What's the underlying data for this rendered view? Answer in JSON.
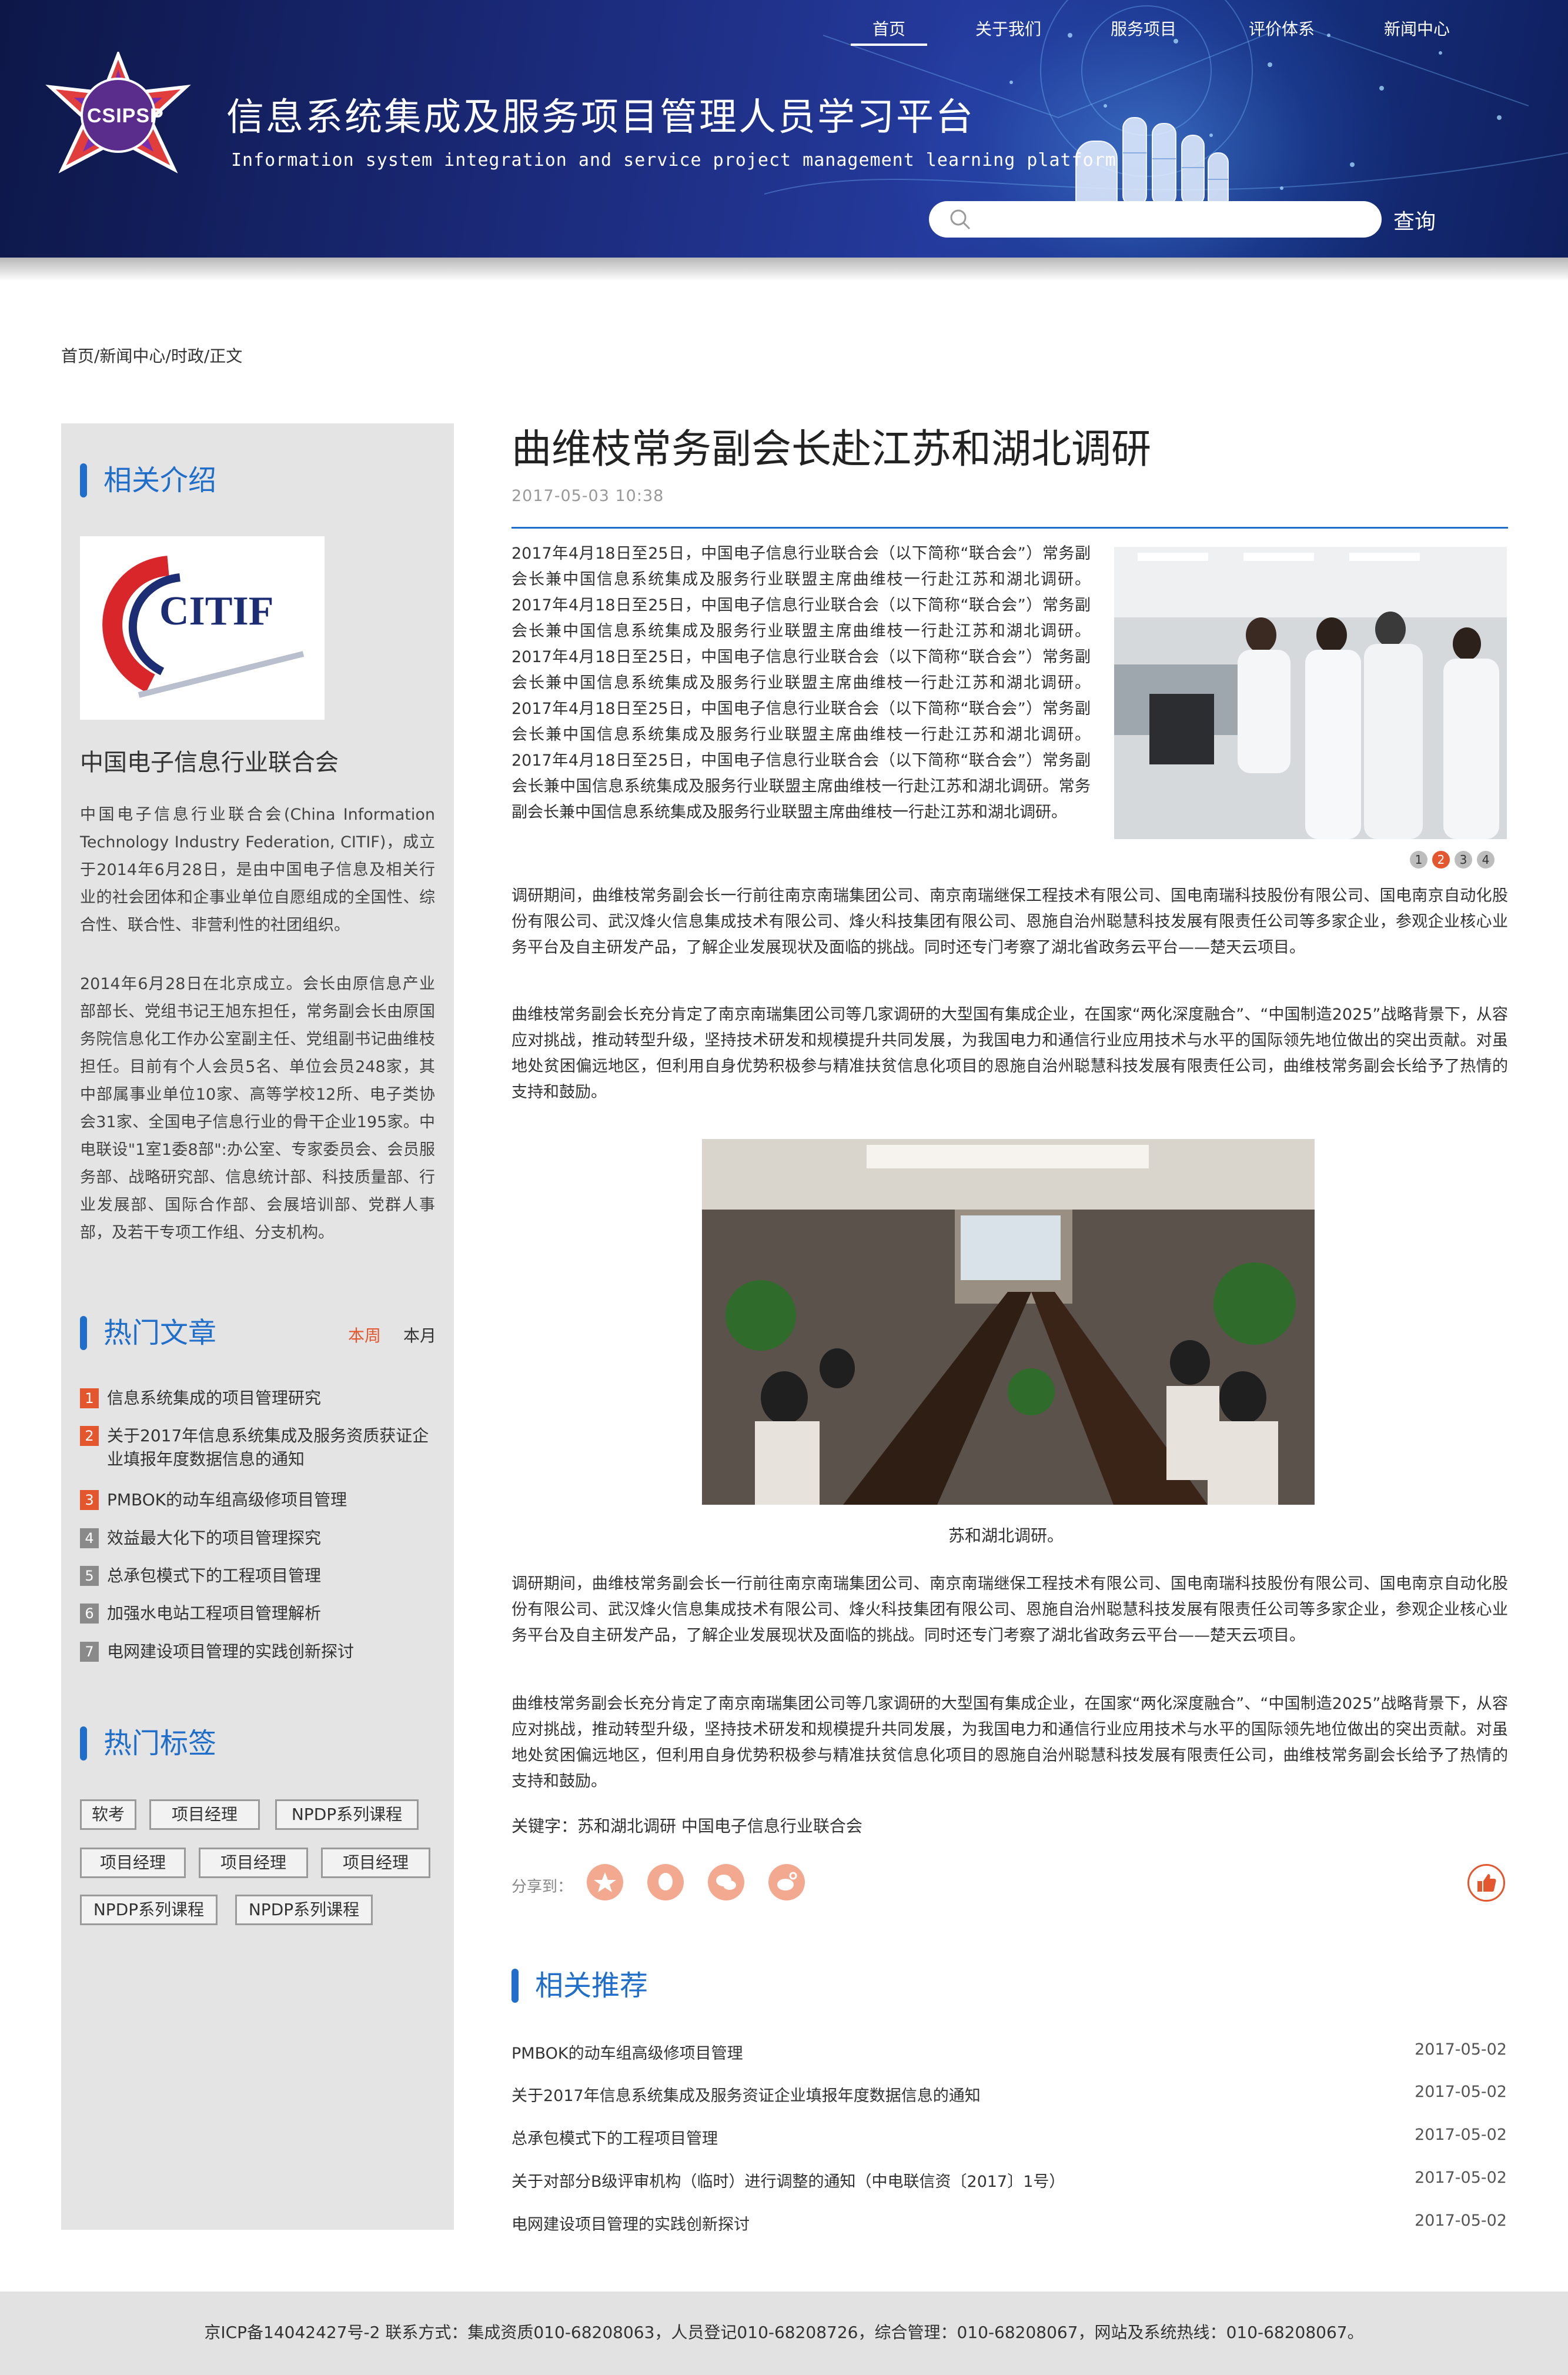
{
  "header": {
    "logo_text": "CSIPSP",
    "title": "信息系统集成及服务项目管理人员学习平台",
    "subtitle": "Information system integration and service project management learning platform",
    "nav": [
      "首页",
      "关于我们",
      "服务项目",
      "评价体系",
      "新闻中心"
    ],
    "active_nav": "首页",
    "search": {
      "placeholder": "",
      "button_label": "查询"
    }
  },
  "breadcrumb": "首页/新闻中心/时政/正文",
  "sidebar": {
    "intro": {
      "heading": "相关介绍",
      "image_logo_text": "CITIF",
      "org_name": "中国电子信息行业联合会",
      "paragraphs": [
        "中国电子信息行业联合会(China Information Technology Industry Federation, CITIF)，成立于2014年6月28日，是由中国电子信息及相关行业的社会团体和企事业单位自愿组成的全国性、综合性、联合性、非营利性的社团组织。",
        "2014年6月28日在北京成立。会长由原信息产业部部长、党组书记王旭东担任，常务副会长由原国务院信息化工作办公室副主任、党组副书记曲维枝担任。目前有个人会员5名、单位会员248家，其中部属事业单位10家、高等学校12所、电子类协会31家、全国电子信息行业的骨干企业195家。中电联设\"1室1委8部\":办公室、专家委员会、会员服务部、战略研究部、信息统计部、科技质量部、行业发展部、国际合作部、会展培训部、党群人事部，及若干专项工作组、分支机构。"
      ]
    },
    "hot_articles": {
      "heading": "热门文章",
      "tabs": [
        "本周",
        "本月"
      ],
      "items": [
        {
          "num": "1",
          "title": "信息系统集成的项目管理研究"
        },
        {
          "num": "2",
          "title": "关于2017年信息系统集成及服务资质获证企业填报年度数据信息的通知"
        },
        {
          "num": "3",
          "title": "PMBOK的动车组高级修项目管理"
        },
        {
          "num": "4",
          "title": "效益最大化下的项目管理探究"
        },
        {
          "num": "5",
          "title": "总承包模式下的工程项目管理"
        },
        {
          "num": "6",
          "title": "加强水电站工程项目管理解析"
        },
        {
          "num": "7",
          "title": "电网建设项目管理的实践创新探讨"
        }
      ]
    },
    "hot_tags": {
      "heading": "热门标签",
      "tags": [
        "软考",
        "项目经理",
        "NPDP系列课程",
        "项目经理",
        "项目经理",
        "项目经理",
        "NPDP系列课程",
        "NPDP系列课程"
      ]
    }
  },
  "article": {
    "title": "曲维枝常务副会长赴江苏和湖北调研",
    "date": "2017-05-03 10:38",
    "intro": "2017年4月18日至25日，中国电子信息行业联合会（以下简称“联合会”）常务副会长兼中国信息系统集成及服务行业联盟主席曲维枝一行赴江苏和湖北调研。2017年4月18日至25日，中国电子信息行业联合会（以下简称“联合会”）常务副会长兼中国信息系统集成及服务行业联盟主席曲维枝一行赴江苏和湖北调研。2017年4月18日至25日，中国电子信息行业联合会（以下简称“联合会”）常务副会长兼中国信息系统集成及服务行业联盟主席曲维枝一行赴江苏和湖北调研。2017年4月18日至25日，中国电子信息行业联合会（以下简称“联合会”）常务副会长兼中国信息系统集成及服务行业联盟主席曲维枝一行赴江苏和湖北调研。2017年4月18日至25日，中国电子信息行业联合会（以下简称“联合会”）常务副会长兼中国信息系统集成及服务行业联盟主席曲维枝一行赴江苏和湖北调研。常务副会长兼中国信息系统集成及服务行业联盟主席曲维枝一行赴江苏和湖北调研。",
    "slider_pages": [
      "1",
      "2",
      "3",
      "4"
    ],
    "slider_active": "2",
    "para_visit": "调研期间，曲维枝常务副会长一行前往南京南瑞集团公司、南京南瑞继保工程技术有限公司、国电南瑞科技股份有限公司、国电南京自动化股份有限公司、武汉烽火信息集成技术有限公司、烽火科技集团有限公司、恩施自治州聪慧科技发展有限责任公司等多家企业，参观企业核心业务平台及自主研发产品，了解企业发展现状及面临的挑战。同时还专门考察了湖北省政务云平台——楚天云项目。",
    "para_affirm": "曲维枝常务副会长充分肯定了南京南瑞集团公司等几家调研的大型国有集成企业，在国家“两化深度融合”、“中国制造2025”战略背景下，从容应对挑战，推动转型升级，坚持技术研发和规模提升共同发展，为我国电力和通信行业应用技术与水平的国际领先地位做出的突出贡献。对虽地处贫困偏远地区，但利用自身优势积极参与精准扶贫信息化项目的恩施自治州聪慧科技发展有限责任公司，曲维枝常务副会长给予了热情的支持和鼓励。",
    "caption": "苏和湖北调研。",
    "keywords": "关键字：苏和湖北调研   中国电子信息行业联合会",
    "share_label": "分享到：",
    "share_icons": [
      "qzone-icon",
      "qq-icon",
      "wechat-icon",
      "weibo-icon"
    ]
  },
  "recommend": {
    "heading": "相关推荐",
    "items": [
      {
        "title": "PMBOK的动车组高级修项目管理",
        "date": "2017-05-02"
      },
      {
        "title": "关于2017年信息系统集成及服务资证企业填报年度数据信息的通知",
        "date": "2017-05-02"
      },
      {
        "title": "总承包模式下的工程项目管理",
        "date": "2017-05-02"
      },
      {
        "title": "关于对部分B级评审机构（临时）进行调整的通知（中电联信资〔2017〕1号）",
        "date": "2017-05-02"
      },
      {
        "title": "电网建设项目管理的实践创新探讨",
        "date": "2017-05-02"
      }
    ]
  },
  "footer": "京ICP备14042427号-2  联系方式：集成资质010-68208063，人员登记010-68208726，综合管理：010-68208067，网站及系统热线：010-68208067。",
  "colors": {
    "accent_blue": "#1f6ec9",
    "accent_orange": "#e4572e",
    "header_navy": "#1b2a7a"
  }
}
